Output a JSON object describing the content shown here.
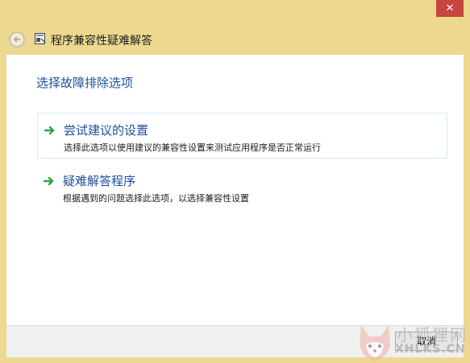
{
  "window": {
    "close_label": "✕",
    "title": "程序兼容性疑难解答"
  },
  "content": {
    "heading": "选择故障排除选项",
    "options": [
      {
        "title": "尝试建议的设置",
        "description": "选择此选项以使用建议的兼容性设置来测试应用程序是否正常运行"
      },
      {
        "title": "疑难解答程序",
        "description": "根据遇到的问题选择此选项，以选择兼容性设置"
      }
    ]
  },
  "footer": {
    "cancel_label": "取消"
  },
  "watermark": {
    "line1": "小狐狸网",
    "line2": "XHLKS.CN"
  },
  "colors": {
    "frame": "#ecd88f",
    "close": "#c7463d",
    "link": "#1f4e9b",
    "arrow": "#2aa83a"
  },
  "icons": {
    "back": "back-arrow-icon",
    "app": "program-icon",
    "option_arrow": "green-arrow-icon",
    "watermark": "fox-logo-icon"
  }
}
